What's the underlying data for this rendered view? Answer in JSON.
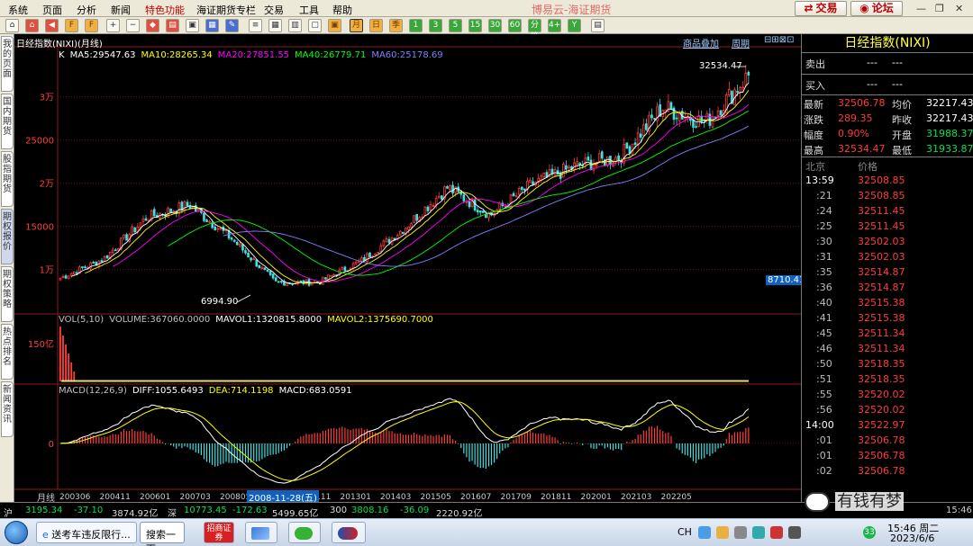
{
  "menubar": {
    "items": [
      "系统",
      "页面",
      "分析",
      "新闻",
      "特色功能",
      "海证期货专栏",
      "交易",
      "工具",
      "帮助"
    ],
    "active_index": 4,
    "brand": "博易云-海证期货",
    "trade_button": "交易",
    "forum_button": "论坛"
  },
  "toolbar": {
    "tools": [
      "home",
      "back",
      "f10",
      "zoom-in",
      "zoom-out",
      "special",
      "list",
      "grid",
      "quote",
      "f10-2",
      "calendar"
    ],
    "periods": [
      "日",
      "季",
      "1",
      "3",
      "5",
      "15",
      "30",
      "60",
      "分笔",
      "4+",
      "Y"
    ],
    "selected_period": "月"
  },
  "left_tabs": [
    {
      "label": "我的页面",
      "selected": false
    },
    {
      "label": "国内期货",
      "selected": false
    },
    {
      "label": "股指期货",
      "selected": false
    },
    {
      "label": "期权报价",
      "selected": true
    },
    {
      "label": "期权策略",
      "selected": false
    },
    {
      "label": "热点排名",
      "selected": false
    },
    {
      "label": "新闻资讯",
      "selected": false
    }
  ],
  "chart": {
    "title": "日经指数(NIXI)(月线)",
    "overlay_link": "商品叠加",
    "period_link": "周期",
    "ma_legend": [
      {
        "label": "K",
        "color": "#ffffff"
      },
      {
        "label": "MA5:29547.63",
        "color": "#ffffff"
      },
      {
        "label": "MA10:28265.34",
        "color": "#ffff00"
      },
      {
        "label": "MA20:27851.55",
        "color": "#ff00ff"
      },
      {
        "label": "MA40:26779.71",
        "color": "#00ff00"
      },
      {
        "label": "MA60:25178.69",
        "color": "#8080ff"
      }
    ],
    "price_axis": [
      "3万",
      "25000",
      "2万",
      "15000",
      "1万"
    ],
    "high_label": "32534.47",
    "low_label": "6994.90",
    "cursor_price": "8710.41",
    "vol_legend": [
      {
        "label": "VOL(5,10)",
        "color": "#c0c0c0"
      },
      {
        "label": "VOLUME:367060.0000",
        "color": "#c0c0c0"
      },
      {
        "label": "MAVOL1:1320815.8000",
        "color": "#ffffff"
      },
      {
        "label": "MAVOL2:1375690.7000",
        "color": "#ffff00"
      }
    ],
    "vol_axis": [
      "150亿"
    ],
    "macd_legend": [
      {
        "label": "MACD(12,26,9)",
        "color": "#c0c0c0"
      },
      {
        "label": "DIFF:1055.6493",
        "color": "#ffffff"
      },
      {
        "label": "DEA:714.1198",
        "color": "#ffff00"
      },
      {
        "label": "MACD:683.0591",
        "color": "#ffffff"
      }
    ],
    "macd_axis": [
      "0"
    ],
    "period_label": "月线",
    "date_ticks": [
      "200306",
      "200411",
      "200601",
      "200703",
      "200805",
      "009",
      "201111",
      "201301",
      "201403",
      "201505",
      "201607",
      "201709",
      "201811",
      "202001",
      "202103",
      "202205"
    ],
    "cursor_date": "2008-11-28(五)"
  },
  "quote": {
    "title": "日经指数(NIXI)",
    "sell_label": "卖出",
    "sell_value": "---",
    "sell_vol": "---",
    "buy_label": "买入",
    "buy_value": "---",
    "buy_vol": "---",
    "rows": [
      {
        "k1": "最新",
        "v1": "32506.78",
        "k2": "均价",
        "v2": "32217.43"
      },
      {
        "k1": "涨跌",
        "v1": "289.35",
        "k2": "昨收",
        "v2": "32217.43"
      },
      {
        "k1": "幅度",
        "v1": "0.90%",
        "k2": "开盘",
        "v2": "31988.37"
      },
      {
        "k1": "最高",
        "v1": "32534.47",
        "k2": "最低",
        "v2": "31933.87"
      }
    ],
    "ticks_header_time": "北京",
    "ticks_header_price": "价格",
    "ticks": [
      {
        "time": "13:59",
        "price": "32508.85"
      },
      {
        "time": ":21",
        "price": "32508.85"
      },
      {
        "time": ":24",
        "price": "32511.45"
      },
      {
        "time": ":25",
        "price": "32511.45"
      },
      {
        "time": ":30",
        "price": "32502.03"
      },
      {
        "time": ":31",
        "price": "32502.03"
      },
      {
        "time": ":35",
        "price": "32514.87"
      },
      {
        "time": ":36",
        "price": "32514.87"
      },
      {
        "time": ":40",
        "price": "32515.38"
      },
      {
        "time": ":41",
        "price": "32515.38"
      },
      {
        "time": ":45",
        "price": "32511.34"
      },
      {
        "time": ":46",
        "price": "32511.34"
      },
      {
        "time": ":50",
        "price": "32518.35"
      },
      {
        "time": ":51",
        "price": "32518.35"
      },
      {
        "time": ":55",
        "price": "32520.02"
      },
      {
        "time": ":56",
        "price": "32520.02"
      },
      {
        "time": "14:00",
        "price": "32522.97"
      },
      {
        "time": ":01",
        "price": "32506.78"
      },
      {
        "time": ":01",
        "price": "32506.78"
      },
      {
        "time": ":02",
        "price": "32506.78"
      }
    ]
  },
  "statusbar": {
    "sh_label": "沪",
    "sh_price": "3195.34",
    "sh_change": "-37.10",
    "sh_amount": "3874.92亿",
    "sz_label": "深",
    "sz_price": "10773.45",
    "sz_change": "-172.63",
    "sz_amount": "5499.65亿",
    "c300_label": "300",
    "c300_price": "3808.16",
    "c300_change": "-36.09",
    "c300_amount": "2220.92亿",
    "time": "15:46"
  },
  "taskbar": {
    "item1": "送考车违反限行...",
    "item2": "搜索一下",
    "zhaoshang": "招商证券",
    "lang": "CH",
    "clock_time": "15:46 周二",
    "clock_date": "2023/6/6",
    "notify_count": "33"
  },
  "watermark": "有钱有梦",
  "chart_data": {
    "type": "candlestick",
    "title": "日经指数(NIXI)(月线)",
    "yrange": [
      6000,
      33500
    ],
    "x": [
      "200306",
      "200411",
      "200601",
      "200703",
      "200805",
      "200811",
      "201111",
      "201301",
      "201403",
      "201505",
      "201607",
      "201709",
      "201811",
      "202001",
      "202103",
      "202205",
      "202306"
    ],
    "close": [
      9000,
      11200,
      16000,
      17500,
      13500,
      8500,
      8500,
      11000,
      14800,
      19500,
      16300,
      20000,
      22000,
      23000,
      28800,
      27000,
      32500
    ],
    "marked_high": 32534.47,
    "marked_low": 6994.9
  }
}
